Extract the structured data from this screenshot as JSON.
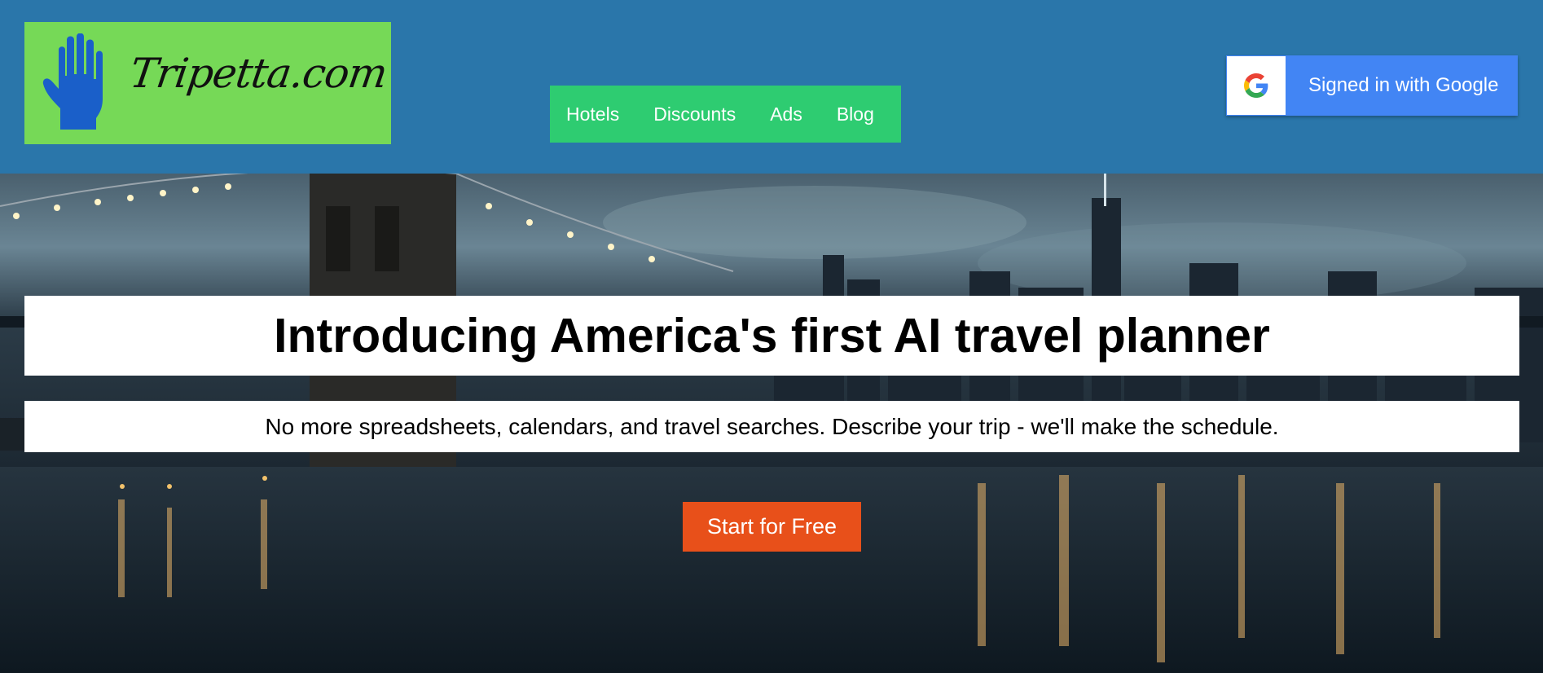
{
  "header": {
    "logo": {
      "brand_text": "Tripetta.com",
      "icon": "hand-icon",
      "background_color": "#76d957",
      "icon_color": "#1a5fc9"
    },
    "nav": {
      "background_color": "#2ecc71",
      "items": [
        {
          "label": "Hotels"
        },
        {
          "label": "Discounts"
        },
        {
          "label": "Ads"
        },
        {
          "label": "Blog"
        }
      ]
    },
    "google_signin": {
      "label": "Signed in with Google",
      "icon": "google-g-icon",
      "background_color": "#4285f4"
    },
    "background_color": "#2a76aa"
  },
  "hero": {
    "background_image": "night city skyline with bridge over river",
    "headline": "Introducing America's first AI travel planner",
    "subheadline": "No more spreadsheets, calendars, and travel searches. Describe your trip - we'll make the schedule.",
    "cta": {
      "label": "Start for Free",
      "background_color": "#e8501a"
    }
  }
}
